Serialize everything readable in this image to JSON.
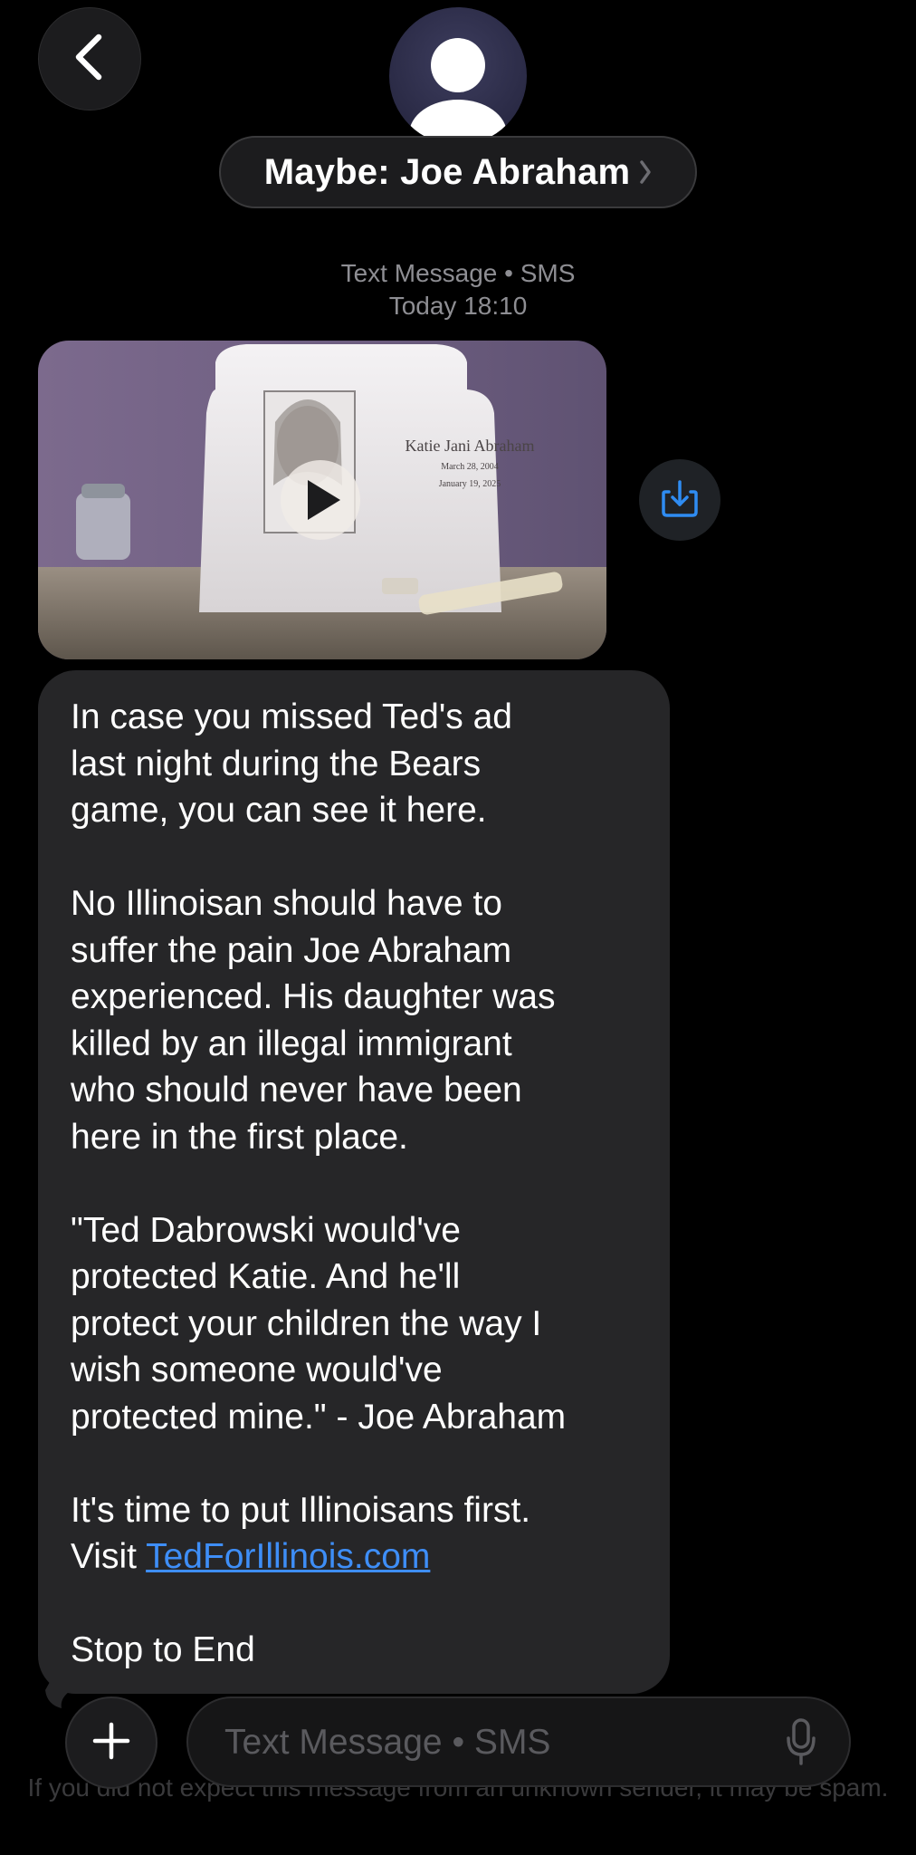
{
  "header": {
    "contact_name": "Maybe: Joe Abraham",
    "service_label": "Text Message • SMS",
    "timestamp": "Today 18:10",
    "back_icon": "chevron-left-icon",
    "avatar_icon": "person-silhouette-icon"
  },
  "attachment": {
    "type": "video",
    "urn_name": "Katie Jani Abraham",
    "urn_birth": "March 28, 2004",
    "urn_death": "January 19, 2025",
    "play_icon": "play-icon",
    "save_icon": "download-icon"
  },
  "message": {
    "p1": "In case you missed Ted's ad\nlast night during the Bears\ngame, you can see it here.",
    "p2": "No Illinoisan should have to\nsuffer the pain Joe Abraham\nexperienced. His daughter was\nkilled by an illegal immigrant\nwho should never have been\nhere in the first place.",
    "p3": "\"Ted Dabrowski would've\nprotected Katie. And he'll\nprotect your children the way I\nwish someone would've\nprotected mine.\" - Joe Abraham",
    "p4_line1": "It's time to put Illinoisans first.",
    "p4_visit": "Visit ",
    "p4_link": "TedForIllinois.com",
    "p5": "Stop to End"
  },
  "composer": {
    "placeholder": "Text Message • SMS",
    "value": "",
    "plus_icon": "plus-icon",
    "mic_icon": "microphone-icon"
  },
  "footer": {
    "spam_note": "If you did not expect this message from an unknown sender, it may be spam."
  },
  "colors": {
    "background": "#000000",
    "bubble": "#262628",
    "link": "#3e8ef7",
    "accent_save": "#2f8cf2",
    "meta_text": "#8e8e93"
  }
}
